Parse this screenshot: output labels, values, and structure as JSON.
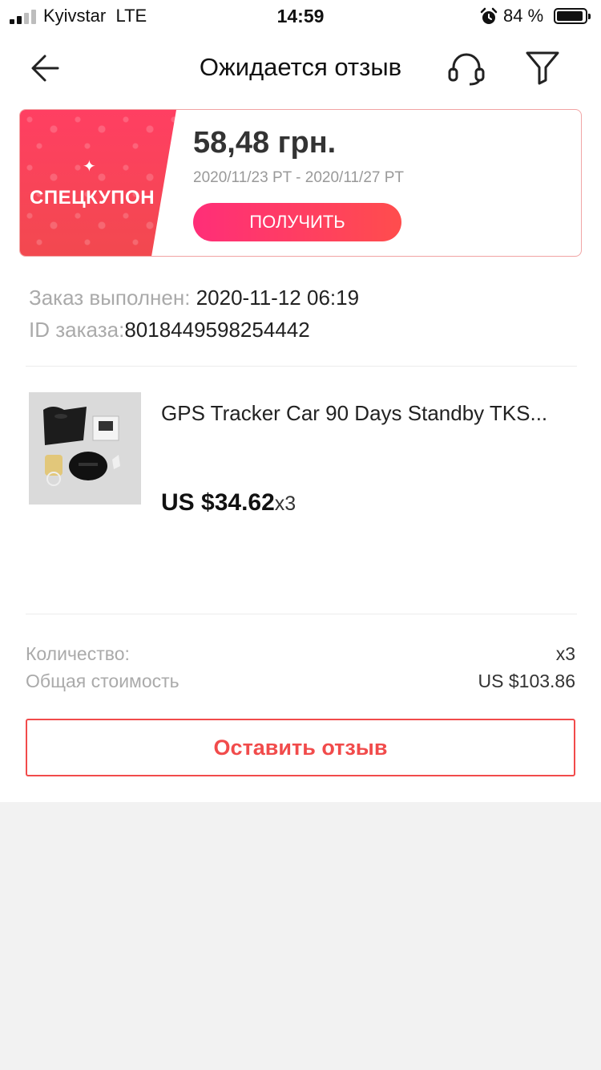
{
  "status_bar": {
    "carrier": "Kyivstar",
    "network": "LTE",
    "time": "14:59",
    "battery_percent": "84 %"
  },
  "header": {
    "title": "Ожидается отзыв",
    "back_icon": "arrow-left-icon",
    "support_icon": "headset-icon",
    "filter_icon": "filter-icon"
  },
  "coupon": {
    "label": "СПЕЦКУПОН",
    "amount": "58,48 грн.",
    "dates": "2020/11/23 PT - 2020/11/27 PT",
    "button_label": "ПОЛУЧИТЬ"
  },
  "order": {
    "completed_label": "Заказ выполнен:",
    "completed_value": " 2020-11-12 06:19",
    "id_label": "ID заказа:",
    "id_value": "8018449598254442"
  },
  "product": {
    "title": "GPS Tracker Car 90 Days Standby TKS...",
    "price": "US $34.62",
    "qty": "x3"
  },
  "summary": {
    "quantity_label": "Количество:",
    "quantity_value": "x3",
    "total_label": "Общая стоимость",
    "total_value": "US $103.86"
  },
  "actions": {
    "review_button": "Оставить отзыв"
  },
  "colors": {
    "accent": "#f14b4b",
    "coupon_gradient_start": "#ff2e78",
    "coupon_gradient_end": "#ff4d4d"
  }
}
